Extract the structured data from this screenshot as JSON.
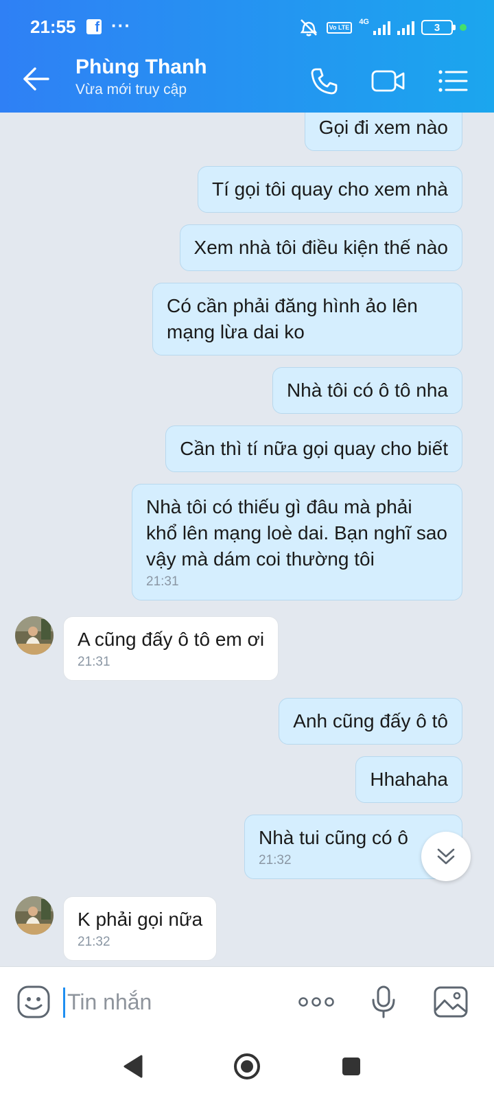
{
  "status_bar": {
    "time": "21:55",
    "fb_glyph": "f",
    "dots": "···",
    "volte": "Vo LTE",
    "network": "4G",
    "battery": "3"
  },
  "header": {
    "name": "Phùng Thanh",
    "status": "Vừa mới truy cập"
  },
  "messages": [
    {
      "dir": "out",
      "text": "Gọi đi xem nào",
      "time": ""
    },
    {
      "dir": "out",
      "text": "Tí gọi tôi quay cho xem nhà",
      "time": ""
    },
    {
      "dir": "out",
      "text": "Xem nhà tôi điều kiện thế nào",
      "time": ""
    },
    {
      "dir": "out",
      "text": "Có cần phải đăng hình ảo lên mạng lừa dai ko",
      "time": ""
    },
    {
      "dir": "out",
      "text": "Nhà tôi có ô tô nha",
      "time": ""
    },
    {
      "dir": "out",
      "text": "Cần thì tí nữa gọi quay cho biết",
      "time": ""
    },
    {
      "dir": "out",
      "text": "Nhà tôi có thiếu gì đâu mà phải khổ lên mạng loè dai. Bạn nghĩ sao vậy mà dám coi thường tôi",
      "time": "21:31"
    },
    {
      "dir": "in",
      "text": "A cũng đấy ô tô em ơi",
      "time": "21:31"
    },
    {
      "dir": "out",
      "text": "Anh cũng đấy ô tô",
      "time": ""
    },
    {
      "dir": "out",
      "text": "Hhahaha",
      "time": ""
    },
    {
      "dir": "out",
      "text": "Nhà tui cũng có ô",
      "time": "21:32"
    },
    {
      "dir": "in",
      "text": "K phải gọi nữa",
      "time": "21:32"
    }
  ],
  "input": {
    "placeholder": "Tin nhắn"
  },
  "icons": {
    "back": "arrow-left-icon",
    "call": "phone-icon",
    "video": "video-camera-icon",
    "menu": "list-menu-icon",
    "sticker": "sticker-face-icon",
    "more": "more-dots-icon",
    "mic": "microphone-icon",
    "image": "image-gallery-icon",
    "scroll": "chevrons-down-icon",
    "nav_back": "nav-back-icon",
    "nav_home": "nav-home-icon",
    "nav_recent": "nav-recent-icon"
  },
  "colors": {
    "header_start": "#2f80f5",
    "header_end": "#1ba6ee",
    "bubble_out": "#d5eefe",
    "bubble_in": "#ffffff",
    "chat_bg": "#e3e8ef",
    "accent": "#1f8ef1"
  }
}
